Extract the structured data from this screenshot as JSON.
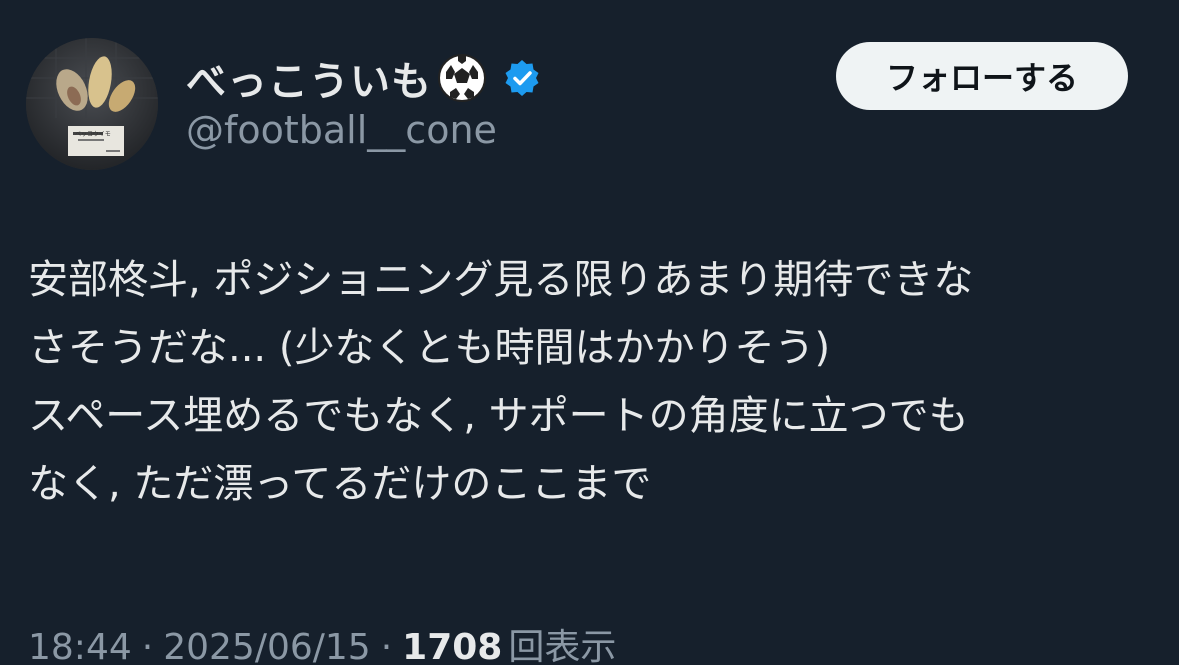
{
  "author": {
    "display_name": "べっこういも",
    "handle": "@football__cone",
    "avatar_caption": "ベッコウイモ",
    "name_emoji": "soccer-ball-icon",
    "verified_icon": "verified-badge-icon"
  },
  "follow_button": {
    "label": "フォローする"
  },
  "tweet": {
    "lines": [
      "安部柊斗, ポジショニング見る限りあまり期待できな",
      "さそうだな... (少なくとも時間はかかりそう)",
      "スペース埋めるでもなく, サポートの角度に立つでも",
      "なく, ただ漂ってるだけのここまで"
    ]
  },
  "meta": {
    "time": "18:44",
    "separator": "·",
    "date": "2025/06/15",
    "views_count": "1708",
    "views_label": "回表示"
  },
  "colors": {
    "background": "#16202c",
    "text_primary": "#e7e9ea",
    "text_secondary": "#8b98a5",
    "verified_blue": "#1d9bf0",
    "follow_button_bg": "#eff3f4"
  }
}
